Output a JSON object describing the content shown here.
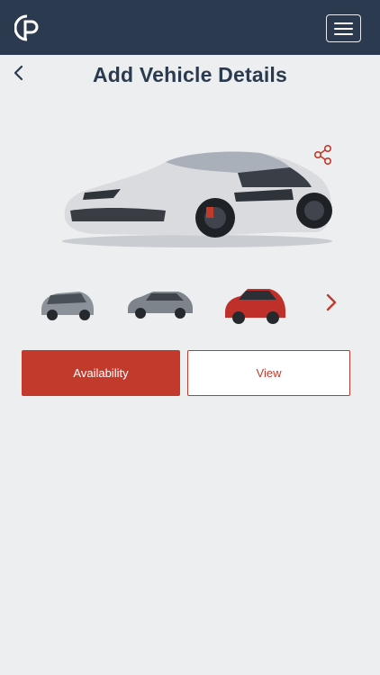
{
  "header": {
    "logo_icon": "parking-p-logo",
    "menu_icon": "hamburger-menu-icon"
  },
  "page": {
    "title": "Add Vehicle Details",
    "back_icon": "chevron-left-icon"
  },
  "main_image": {
    "share_icon": "share-icon",
    "description_icon": "car-photo"
  },
  "thumbnails": {
    "next_icon": "chevron-right-icon"
  },
  "actions": {
    "availability_label": "Availability",
    "view_label": "View"
  },
  "colors": {
    "header_bg": "#2b3a4e",
    "accent": "#c23a2b",
    "page_bg": "#eceef0"
  }
}
